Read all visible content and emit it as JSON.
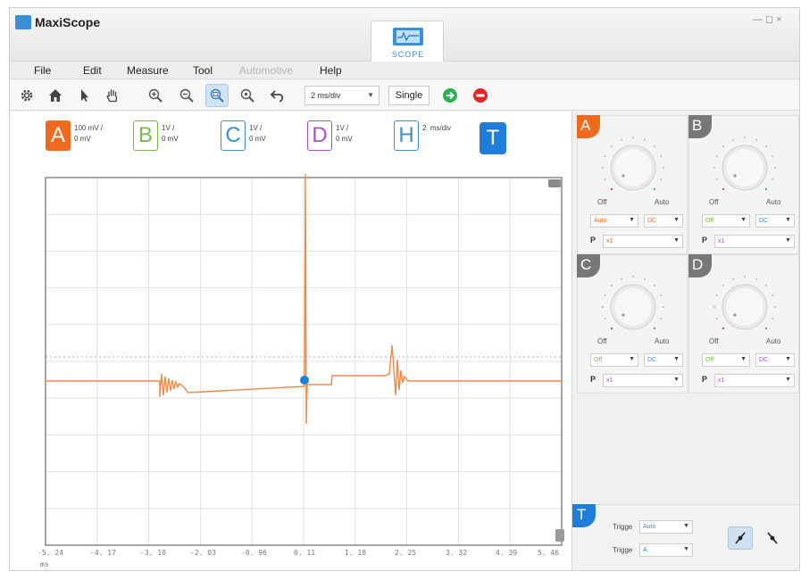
{
  "app": {
    "title": "MaxiScope",
    "window_controls": "— ◻ ×"
  },
  "scope_tab": {
    "label": "SCOPE"
  },
  "menu": [
    {
      "label": "File",
      "enabled": true
    },
    {
      "label": "Edit",
      "enabled": true
    },
    {
      "label": "Measure",
      "enabled": true
    },
    {
      "label": "Tool",
      "enabled": true
    },
    {
      "label": "Automotive",
      "enabled": false
    },
    {
      "label": "Help",
      "enabled": true
    }
  ],
  "toolbar": {
    "icons": [
      "settings-icon",
      "home-icon",
      "pointer-icon",
      "pan-hand-icon",
      "zoom-in-icon",
      "zoom-out-icon",
      "zoom-box-icon",
      "zoom-reset-icon",
      "undo-icon"
    ],
    "timebase": "2  ms/div",
    "single_label": "Single",
    "run_color": "#2db34a",
    "stop_color": "#e02828"
  },
  "channels_header": [
    {
      "letter": "A",
      "line1": "100 mV /",
      "line2": "0 mV",
      "color": "#ee6a1f",
      "filled": true
    },
    {
      "letter": "B",
      "line1": "1V /",
      "line2": "0 mV",
      "color": "#7ab648",
      "filled": false
    },
    {
      "letter": "C",
      "line1": "1V /",
      "line2": "0 mV",
      "color": "#3a8fd6",
      "filled": false
    },
    {
      "letter": "D",
      "line1": "1V /",
      "line2": "0 mV",
      "color": "#a84fd0",
      "filled": false
    },
    {
      "letter": "H",
      "line1": "2  ms/div",
      "line2": "",
      "color": "#3a8fd6",
      "filled": false
    }
  ],
  "trigger_badge": "T",
  "x_axis": {
    "ticks": [
      "-5. 24",
      "-4. 17",
      "-3. 10",
      "-2. 03",
      "-0. 96",
      "0. 11",
      "1. 18",
      "2. 25",
      "3. 32",
      "4. 39",
      "5. 46"
    ],
    "unit": "ms"
  },
  "trace": {
    "color": "#ee8a4a",
    "trigger_marker_color": "#1f7fd8"
  },
  "channel_panels": [
    {
      "letter": "A",
      "color": "#ee6a1f",
      "off": "Off",
      "auto": "Auto",
      "mode": "Auto",
      "coupling": "DC",
      "probe_label": "P",
      "probe": "x1",
      "active": true
    },
    {
      "letter": "B",
      "color": "#777777",
      "off": "Off",
      "auto": "Auto",
      "mode": "Off",
      "coupling": "DC",
      "probe_label": "P",
      "probe": "x1",
      "active": false
    },
    {
      "letter": "C",
      "color": "#777777",
      "off": "Off",
      "auto": "Auto",
      "mode": "Off",
      "coupling": "DC",
      "probe_label": "P",
      "probe": "x1",
      "active": false
    },
    {
      "letter": "D",
      "color": "#777777",
      "off": "Off",
      "auto": "Auto",
      "mode": "Off",
      "coupling": "DC",
      "probe_label": "P",
      "probe": "x1",
      "active": false
    }
  ],
  "trigger_panel": {
    "letter": "T",
    "mode_label": "Trigge",
    "mode_value": "Auto",
    "source_label": "Trigge",
    "source_value": "A"
  }
}
